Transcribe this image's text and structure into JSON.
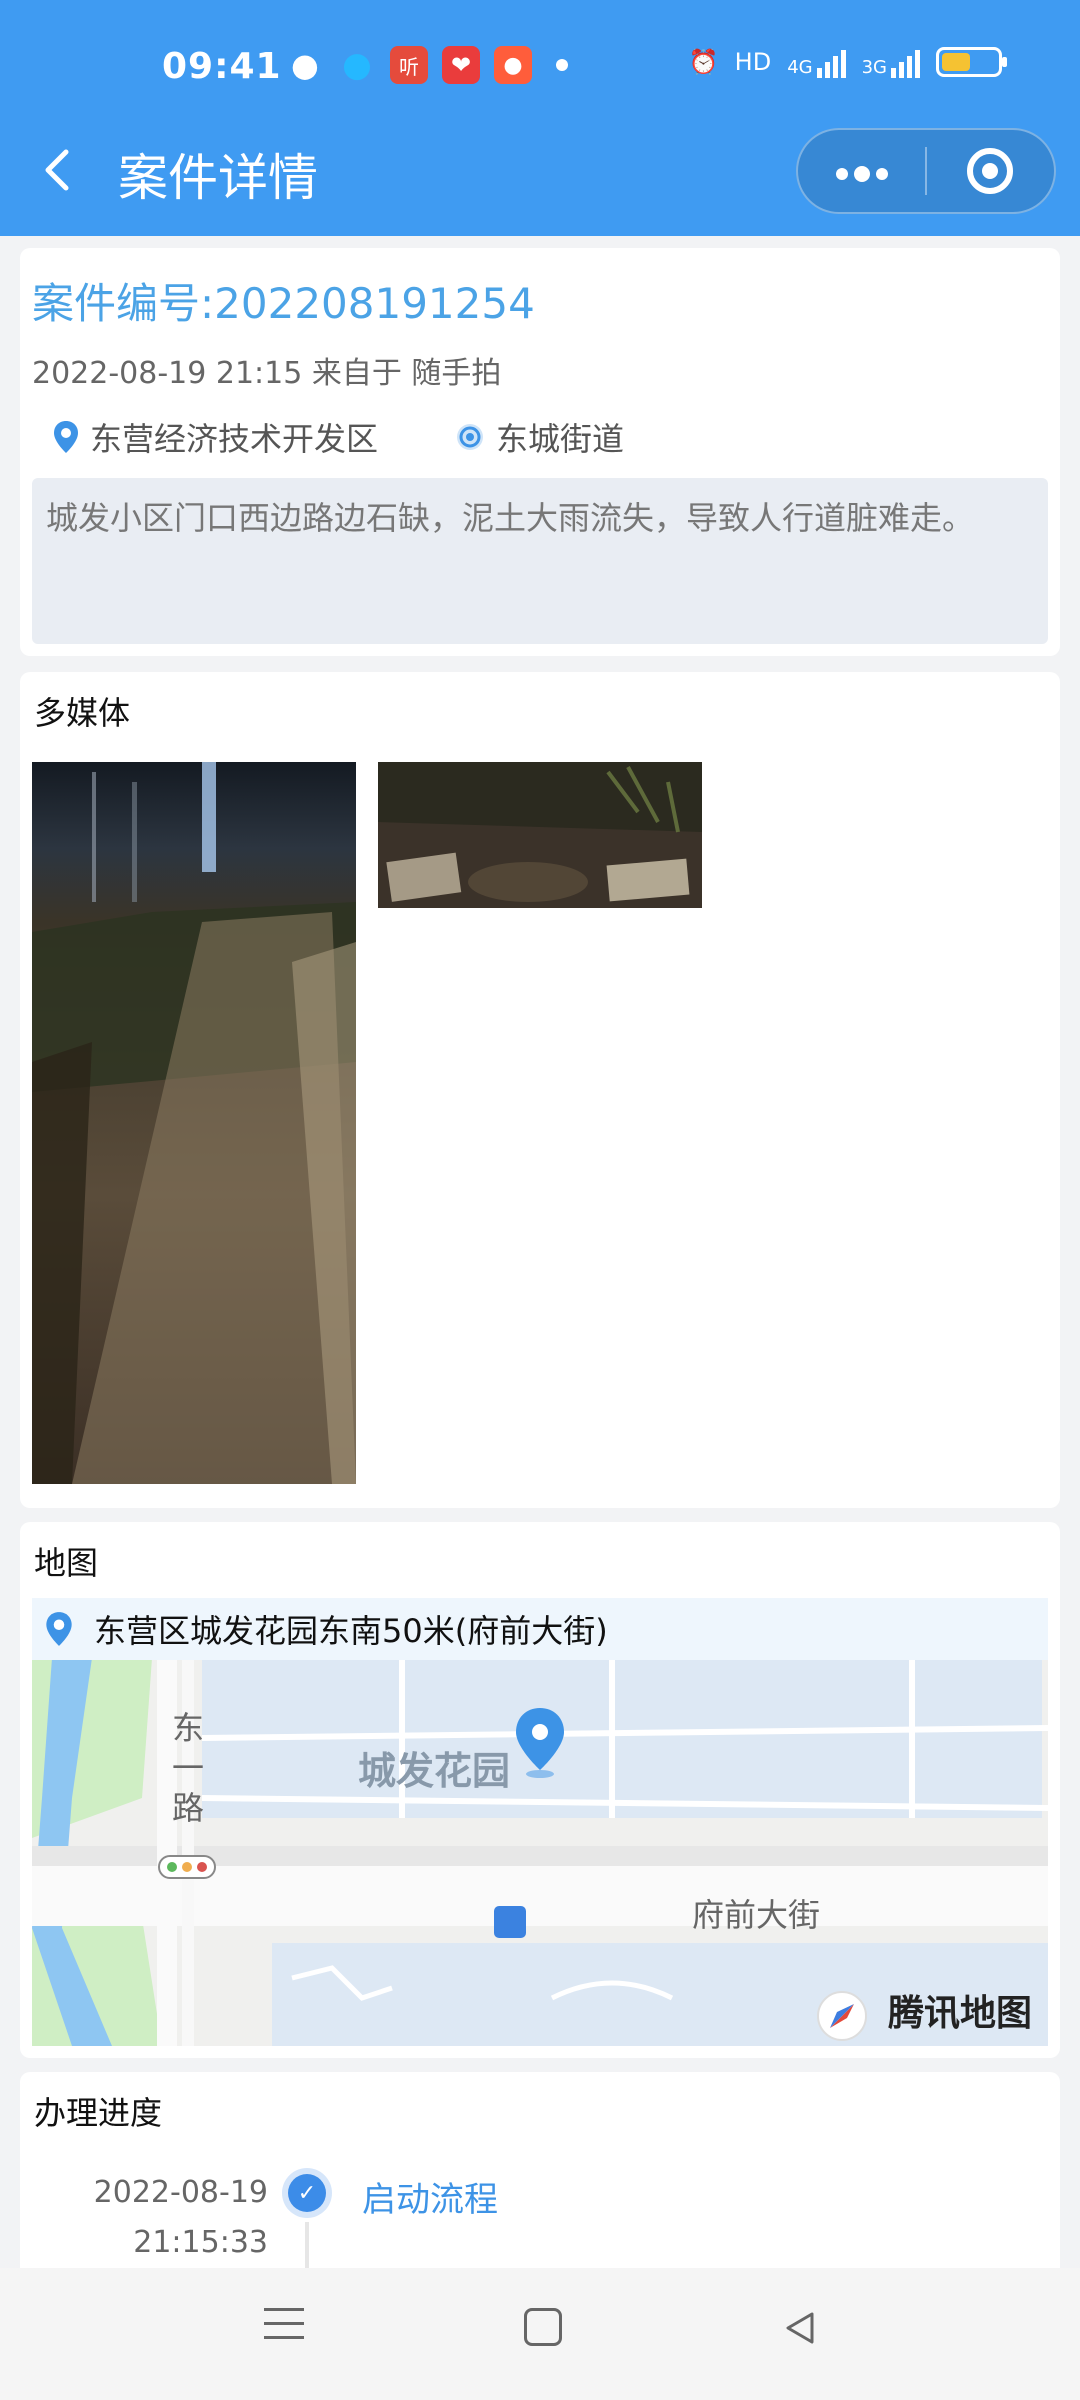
{
  "status_bar": {
    "time": "09:41",
    "network_hd": "HD",
    "network_4g": "4G",
    "network_3g": "3G"
  },
  "nav": {
    "back_icon": "chevron-left-icon",
    "title": "案件详情",
    "more_icon": "more-dots-icon",
    "close_icon": "target-icon"
  },
  "case": {
    "number": "案件编号:202208191254",
    "time_source": "2022-08-19 21:15 来自于 随手拍",
    "district": "东营经济技术开发区",
    "street": "东城街道",
    "description": "城发小区门口西边路边石缺，泥土大雨流失，导致人行道脏难走。"
  },
  "media": {
    "title": "多媒体"
  },
  "map": {
    "title": "地图",
    "address": "东营区城发花园东南50米(府前大街)",
    "labels": {
      "road_vertical": "东一路",
      "area": "城发花园",
      "street": "府前大街",
      "logo": "腾讯地图"
    }
  },
  "progress": {
    "title": "办理进度",
    "steps": [
      {
        "date": "2022-08-19",
        "time": "21:15:33",
        "label": "启动流程"
      }
    ]
  },
  "colors": {
    "header_bg": "#3f9bf2",
    "accent": "#4ba3e6",
    "page_bg": "#f2f3f5"
  }
}
